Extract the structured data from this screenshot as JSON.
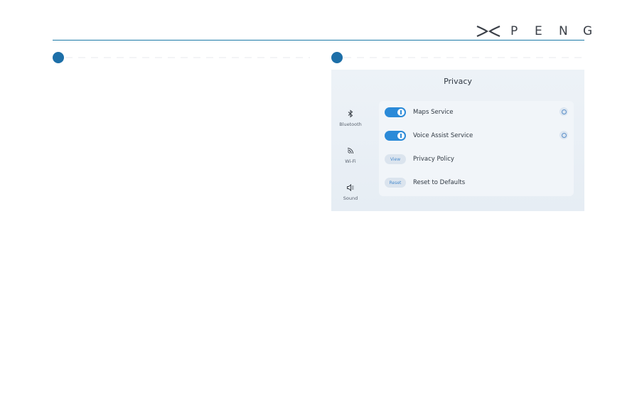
{
  "header": {
    "logo_letters": [
      "P",
      "E",
      "N",
      "G"
    ]
  },
  "screen": {
    "title": "Privacy",
    "sidebar": [
      {
        "label": "Bluetooth",
        "icon": "bluetooth-icon"
      },
      {
        "label": "Wi-Fi",
        "icon": "wifi-icon"
      },
      {
        "label": "Sound",
        "icon": "speaker-icon"
      }
    ],
    "rows": [
      {
        "control": "toggle-on",
        "label": "Maps Service",
        "info": true
      },
      {
        "control": "toggle-on",
        "label": "Voice Assist Service",
        "info": true
      },
      {
        "control": "button",
        "button_label": "View",
        "label": "Privacy Policy"
      },
      {
        "control": "button",
        "button_label": "Reset",
        "label": "Reset to Defaults"
      }
    ]
  },
  "colors": {
    "accent": "#1d6fa8",
    "toggle_on": "#2b8ad8",
    "rule": "#1c7aa8"
  }
}
